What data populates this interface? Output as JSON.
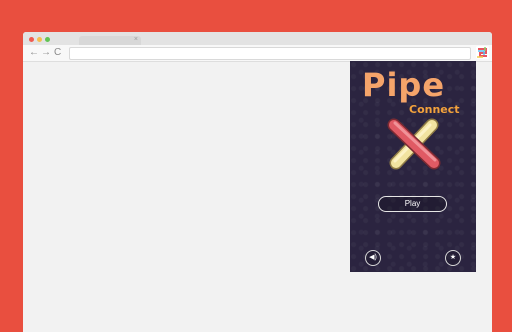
{
  "browser": {
    "tab": {
      "close_glyph": "×"
    },
    "nav": {
      "back_glyph": "←",
      "forward_glyph": "→",
      "reload_glyph": "C"
    },
    "extension_icon": "pipe-connect-extension-icon"
  },
  "game": {
    "title": "Pipe",
    "subtitle": "Connect",
    "play_label": "Play",
    "sound_icon": "speaker-icon",
    "rate_icon": "star-icon",
    "sound_glyph": "◀)",
    "rate_glyph": "★"
  },
  "colors": {
    "page_background": "#e94f3f",
    "game_background": "#2b2440",
    "title_color": "#f5a46a",
    "pipe_red": "#e05a64",
    "pipe_yellow": "#f1e3a0"
  }
}
